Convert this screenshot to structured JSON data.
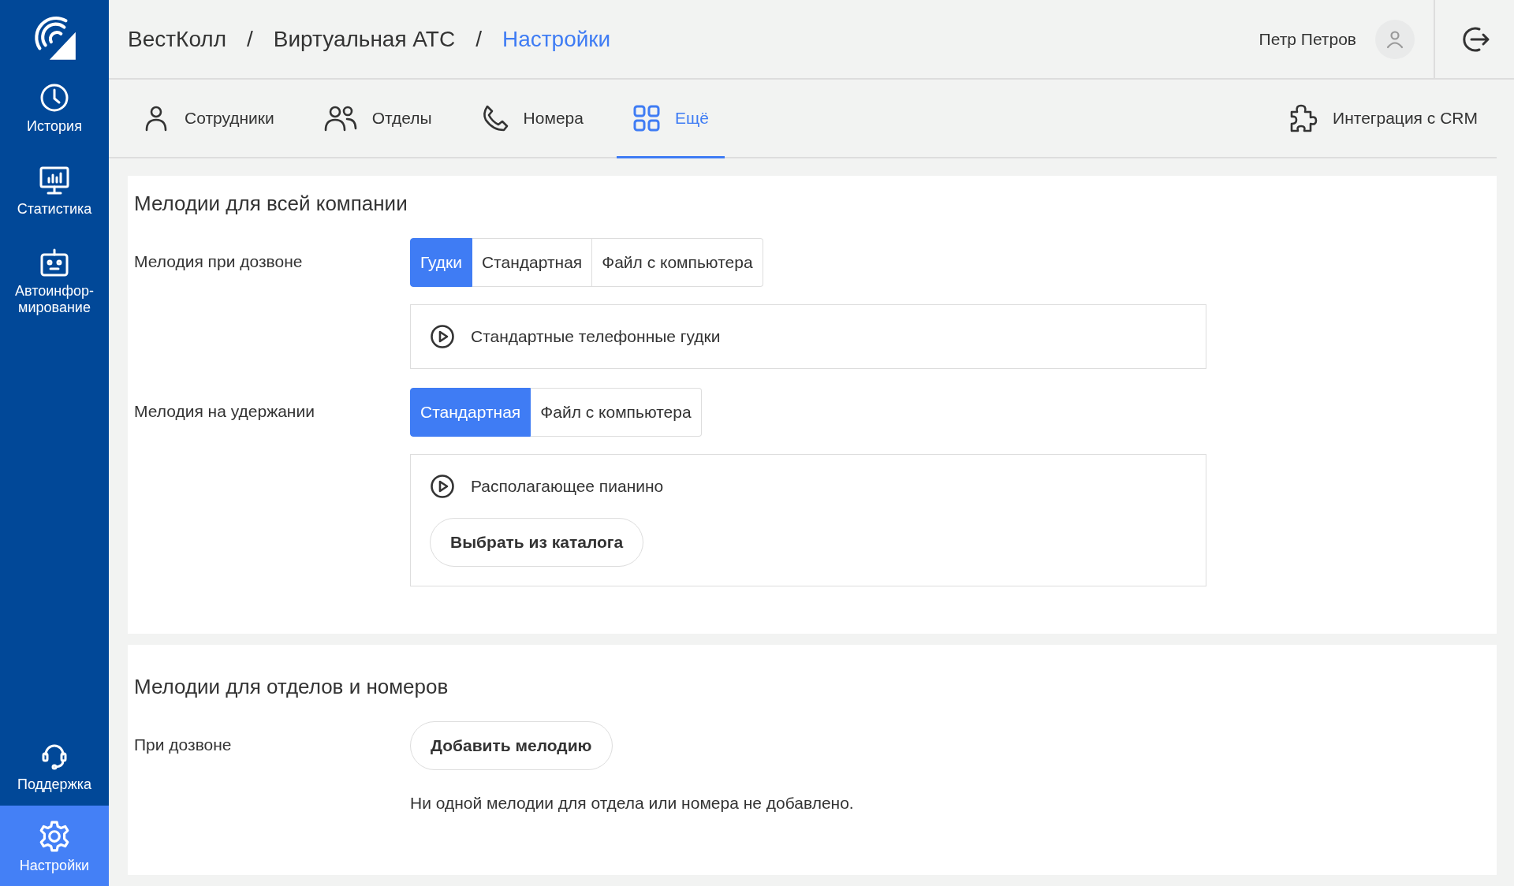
{
  "sidebar": {
    "top_items": [
      {
        "kind": "history",
        "label": "История",
        "selected": false
      },
      {
        "kind": "stats",
        "label": "Статистика",
        "selected": false
      },
      {
        "kind": "robot",
        "label": "Автоинфор-\nмирование",
        "selected": false
      }
    ],
    "bottom_items": [
      {
        "kind": "support",
        "label": "Поддержка",
        "selected": false
      },
      {
        "kind": "settings",
        "label": "Настройки",
        "selected": true
      }
    ]
  },
  "breadcrumbs": [
    {
      "label": "ВестКолл",
      "selected": false
    },
    {
      "label": "Виртуальная АТС",
      "selected": false
    },
    {
      "label": "Настройки",
      "selected": true
    }
  ],
  "breadcrumb_separator": "/",
  "user": {
    "name": "Петр Петров"
  },
  "tabs": [
    {
      "kind": "person",
      "label": "Сотрудники",
      "selected": false
    },
    {
      "kind": "people",
      "label": "Отделы",
      "selected": false
    },
    {
      "kind": "phone",
      "label": "Номера",
      "selected": false
    },
    {
      "kind": "grid",
      "label": "Ещё",
      "selected": true
    }
  ],
  "crm_link": "Интеграция с CRM",
  "company_section": {
    "title": "Мелодии для всей компании",
    "rows": [
      {
        "label": "Мелодия при дозвоне",
        "options": [
          {
            "label": "Гудки",
            "selected": true
          },
          {
            "label": "Стандартная",
            "selected": false
          },
          {
            "label": "Файл с компьютера",
            "selected": false
          }
        ],
        "melody": "Стандартные телефонные гудки"
      },
      {
        "label": "Мелодия на удержании",
        "options": [
          {
            "label": "Стандартная",
            "selected": true
          },
          {
            "label": "Файл с компьютера",
            "selected": false
          }
        ],
        "melody": "Располагающее пианино",
        "button": "Выбрать из каталога"
      }
    ]
  },
  "department_section": {
    "title": "Мелодии для отделов и номеров",
    "label": "При дозвоне",
    "button": "Добавить мелодию",
    "note": "Ни одной мелодии для отдела или номера не добавлено."
  }
}
